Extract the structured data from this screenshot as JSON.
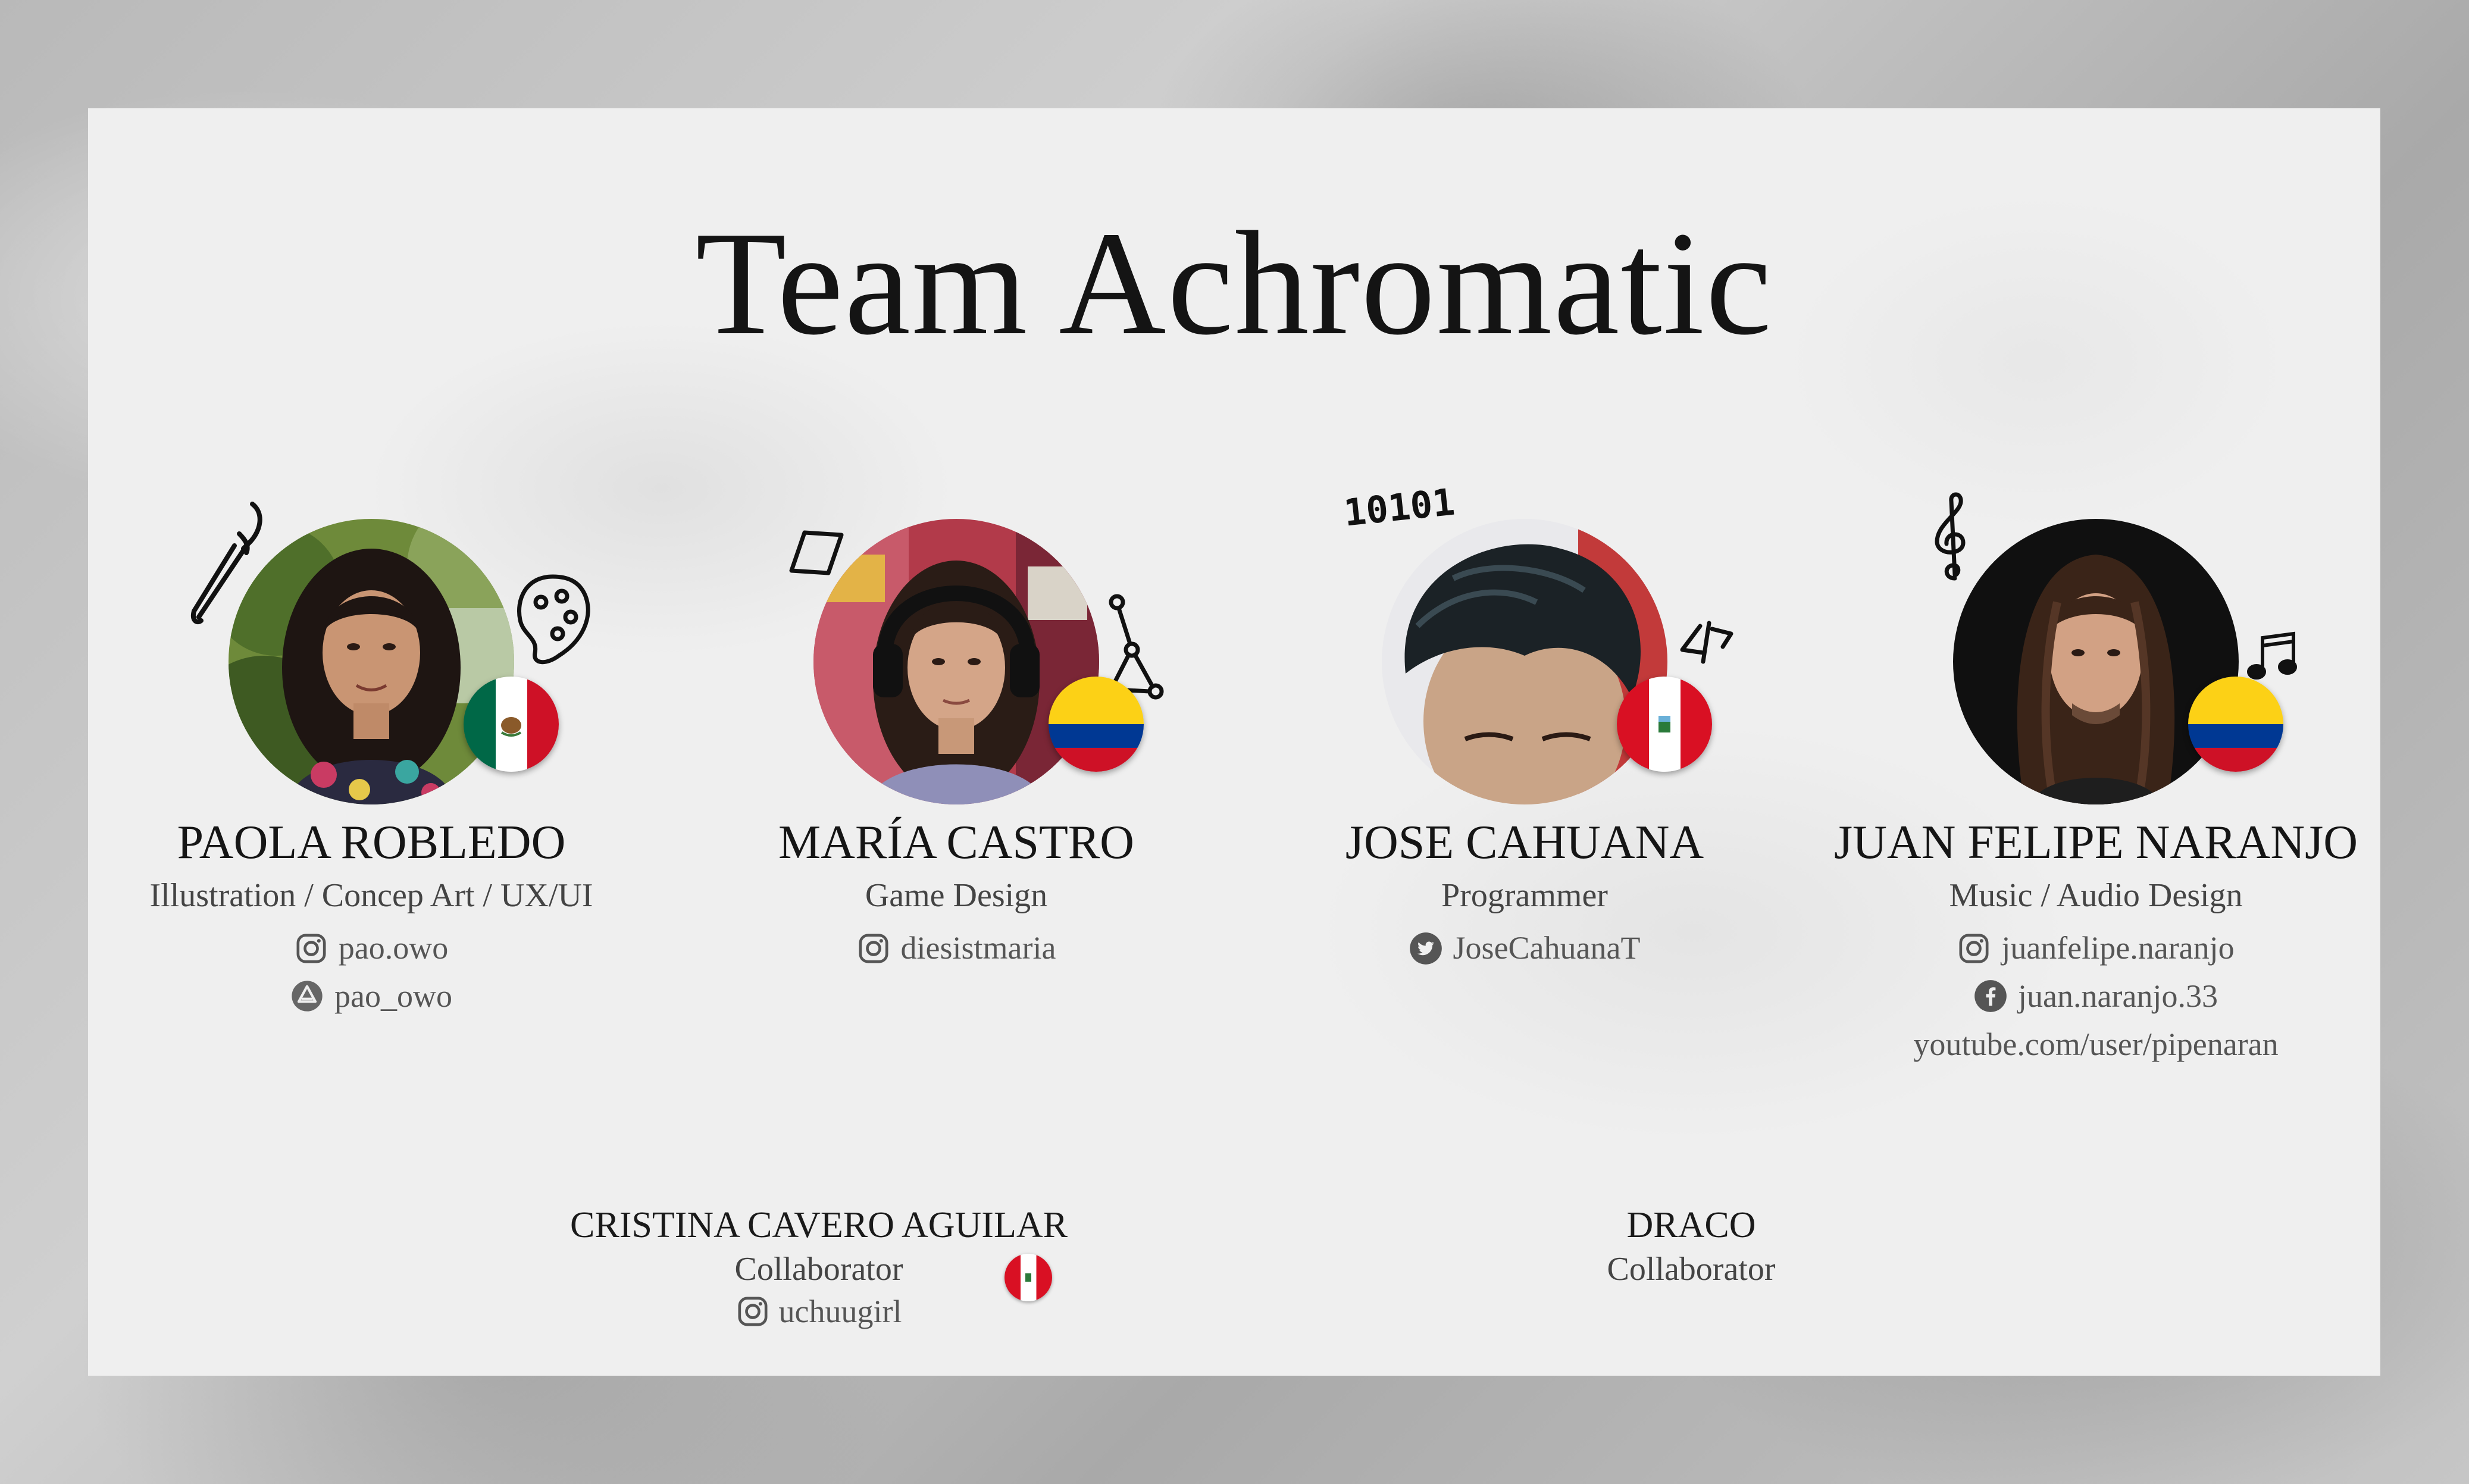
{
  "title": "Team Achromatic",
  "members": [
    {
      "name": "PAOLA ROBLEDO",
      "role": "Illustration / Concep Art / UX/UI",
      "flag": "mexico",
      "socials": [
        {
          "icon": "instagram-icon",
          "handle": "pao.owo"
        },
        {
          "icon": "artstation-icon",
          "handle": "pao_owo"
        }
      ]
    },
    {
      "name": "MARÍA CASTRO",
      "role": "Game Design",
      "flag": "colombia",
      "socials": [
        {
          "icon": "instagram-icon",
          "handle": "diesistmaria"
        }
      ]
    },
    {
      "name": "JOSE CAHUANA",
      "role": "Programmer",
      "flag": "peru",
      "doodle_text": "10101",
      "socials": [
        {
          "icon": "twitter-icon",
          "handle": "JoseCahuanaT"
        }
      ]
    },
    {
      "name": "JUAN FELIPE NARANJO",
      "role": "Music / Audio Design",
      "flag": "colombia",
      "socials": [
        {
          "icon": "instagram-icon",
          "handle": "juanfelipe.naranjo"
        },
        {
          "icon": "facebook-icon",
          "handle": "juan.naranjo.33"
        },
        {
          "icon": "",
          "handle": "youtube.com/user/pipenaran"
        }
      ]
    }
  ],
  "collaborators": [
    {
      "name": "CRISTINA CAVERO AGUILAR",
      "role": "Collaborator",
      "flag": "peru",
      "social": {
        "icon": "instagram-icon",
        "handle": "uchuugirl"
      }
    },
    {
      "name": "DRACO",
      "role": "Collaborator"
    }
  ],
  "colors": {
    "mexico_green": "#006847",
    "mexico_red": "#ce1126",
    "colombia_yellow": "#fcd116",
    "colombia_blue": "#003893",
    "colombia_red": "#ce1126",
    "peru_red": "#d91023",
    "text_dark": "#151515",
    "text_muted": "#555555"
  }
}
